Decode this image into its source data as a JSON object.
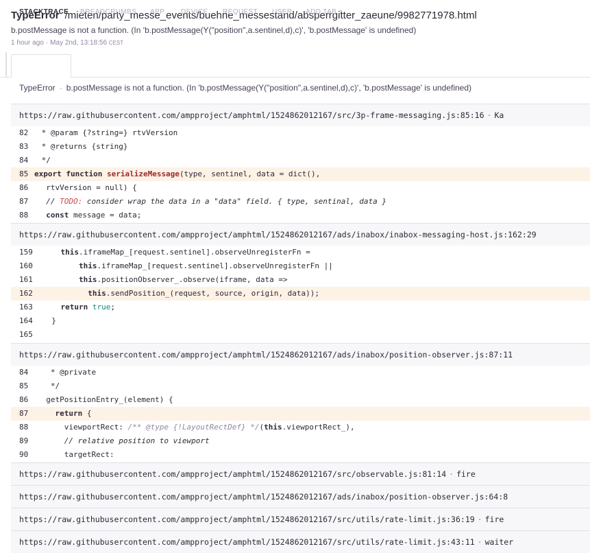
{
  "header": {
    "error_type": "TypeError",
    "culprit": "/mieten/party_messe_events/buehne_messestand/absperrgitter_zaeune/9982771978.html",
    "message": "b.postMessage is not a function. (In 'b.postMessage(Y(\"position\",a.sentinel,d),c)', 'b.postMessage' is undefined)",
    "relative_time": "1 hour ago",
    "sep": "·",
    "absolute_time": "May 2nd, 13:18:56",
    "timezone": "CEST"
  },
  "tabs": [
    "STACKTRACE",
    "BREADCRUMBS",
    "APP",
    "DEVICE",
    "REQUEST",
    "USER",
    "ADD TAB +"
  ],
  "exception": {
    "type": "TypeError",
    "sep": "·",
    "value": "b.postMessage is not a function. (In 'b.postMessage(Y(\"position\",a.sentinel,d),c)', 'b.postMessage' is undefined)"
  },
  "frames": [
    {
      "path": "https://raw.githubusercontent.com/ampproject/amphtml/1524862012167/src/3p-frame-messaging.js:85:16",
      "sep": "·",
      "function": "Ka",
      "lines": [
        {
          "num": "82",
          "text": " * @param {?string=} rtvVersion"
        },
        {
          "num": "83",
          "text": " * @returns {string}"
        },
        {
          "num": "84",
          "text": " */"
        },
        {
          "num": "85",
          "text": "export function serializeMessage(type, sentinel, data = dict(),"
        },
        {
          "num": "86",
          "text": "  rtvVersion = null) {"
        },
        {
          "num": "87",
          "text": "  // TODO: consider wrap the data in a \"data\" field. { type, sentinal, data }"
        },
        {
          "num": "88",
          "text": "  const message = data;"
        }
      ]
    },
    {
      "path": "https://raw.githubusercontent.com/ampproject/amphtml/1524862012167/ads/inabox/inabox-messaging-host.js:162:29",
      "sep": "",
      "function": "",
      "lines": [
        {
          "num": "159",
          "text": "    this.iframeMap_[request.sentinel].observeUnregisterFn ="
        },
        {
          "num": "160",
          "text": "        this.iframeMap_[request.sentinel].observeUnregisterFn ||"
        },
        {
          "num": "161",
          "text": "        this.positionObserver_.observe(iframe, data =>"
        },
        {
          "num": "162",
          "text": "          this.sendPosition_(request, source, origin, data));"
        },
        {
          "num": "163",
          "text": "    return true;"
        },
        {
          "num": "164",
          "text": "  }"
        },
        {
          "num": "165",
          "text": ""
        }
      ]
    },
    {
      "path": "https://raw.githubusercontent.com/ampproject/amphtml/1524862012167/ads/inabox/position-observer.js:87:11",
      "sep": "",
      "function": "",
      "lines": [
        {
          "num": "84",
          "text": "   * @private"
        },
        {
          "num": "85",
          "text": "   */"
        },
        {
          "num": "86",
          "text": "  getPositionEntry_(element) {"
        },
        {
          "num": "87",
          "text": "    return {"
        },
        {
          "num": "88",
          "text": "      viewportRect: /** @type {!LayoutRectDef} */(this.viewportRect_),"
        },
        {
          "num": "89",
          "text": "      // relative position to viewport"
        },
        {
          "num": "90",
          "text": "      targetRect:"
        }
      ]
    },
    {
      "path": "https://raw.githubusercontent.com/ampproject/amphtml/1524862012167/src/observable.js:81:14",
      "sep": "·",
      "function": "fire"
    },
    {
      "path": "https://raw.githubusercontent.com/ampproject/amphtml/1524862012167/ads/inabox/position-observer.js:64:8",
      "sep": "",
      "function": ""
    },
    {
      "path": "https://raw.githubusercontent.com/ampproject/amphtml/1524862012167/src/utils/rate-limit.js:36:19",
      "sep": "·",
      "function": "fire"
    },
    {
      "path": "https://raw.githubusercontent.com/ampproject/amphtml/1524862012167/src/utils/rate-limit.js:43:11",
      "sep": "·",
      "function": "waiter"
    }
  ]
}
